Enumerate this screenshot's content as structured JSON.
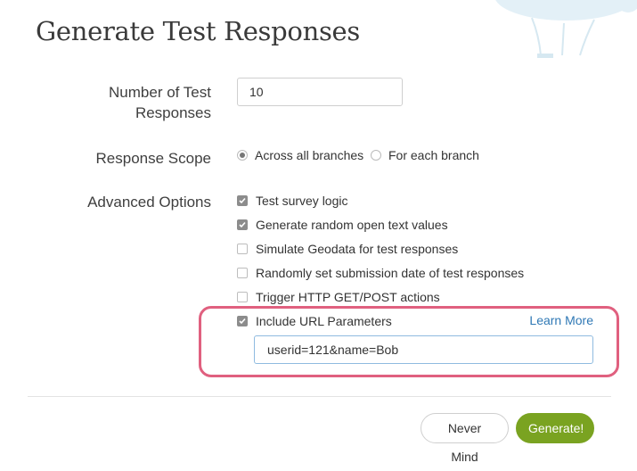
{
  "page": {
    "title": "Generate Test Responses"
  },
  "form": {
    "num_responses": {
      "label": "Number of Test Responses",
      "value": "10"
    },
    "response_scope": {
      "label": "Response Scope",
      "options": [
        {
          "label": "Across all branches",
          "selected": true
        },
        {
          "label": "For each branch",
          "selected": false
        }
      ]
    },
    "advanced": {
      "label": "Advanced Options",
      "options": [
        {
          "label": "Test survey logic",
          "checked": true
        },
        {
          "label": "Generate random open text values",
          "checked": true
        },
        {
          "label": "Simulate Geodata for test responses",
          "checked": false
        },
        {
          "label": "Randomly set submission date of test responses",
          "checked": false
        },
        {
          "label": "Trigger HTTP GET/POST actions",
          "checked": false
        },
        {
          "label": "Include URL Parameters",
          "checked": true
        }
      ],
      "learn_more": "Learn More",
      "url_params_value": "userid=121&name=Bob"
    }
  },
  "footer": {
    "never_mind": "Never Mind",
    "generate": "Generate!"
  },
  "colors": {
    "highlight": "#e0607f",
    "generate_button": "#7aa321",
    "link": "#2f78b5"
  }
}
